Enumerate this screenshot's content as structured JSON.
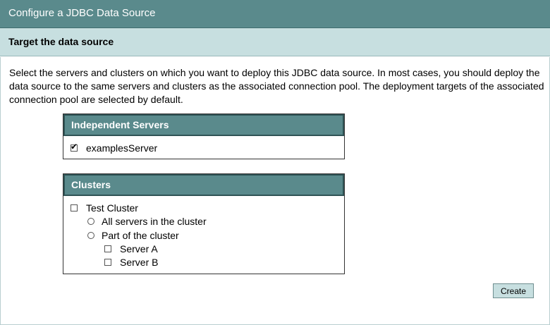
{
  "header": {
    "title": "Configure a JDBC Data Source",
    "subtitle": "Target the data source"
  },
  "intro_text": "Select the servers and clusters on which you want to deploy this JDBC data source. In most cases, you should deploy the data source to the same servers and clusters as the associated connection pool. The deployment targets of the associated connection pool are selected by default.",
  "independent_servers": {
    "heading": "Independent Servers",
    "items": [
      {
        "label": "examplesServer",
        "checked": true
      }
    ]
  },
  "clusters": {
    "heading": "Clusters",
    "cluster": {
      "label": "Test Cluster",
      "checked": false
    },
    "options": [
      {
        "label": "All servers in the cluster",
        "selected": false
      },
      {
        "label": "Part of the cluster",
        "selected": false
      }
    ],
    "servers": [
      {
        "label": "Server A",
        "checked": false
      },
      {
        "label": "Server B",
        "checked": false
      }
    ]
  },
  "actions": {
    "create_label": "Create"
  }
}
